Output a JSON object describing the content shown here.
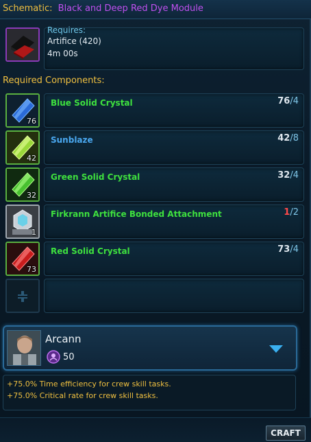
{
  "schematic": {
    "label": "Schematic:",
    "name": "Black and Deep Red Dye Module",
    "icon": "dye-module-icon",
    "requires_label": "Requires:",
    "requirement": "Artifice (420)",
    "time": "4m 00s"
  },
  "components": {
    "title": "Required Components:",
    "items": [
      {
        "name": "Blue Solid Crystal",
        "have": "76",
        "need": "/4",
        "slot_count": "76",
        "name_color": "#3ee03e",
        "insufficient": false,
        "icon": "blue-crystal-icon"
      },
      {
        "name": "Sunblaze",
        "have": "42",
        "need": "/8",
        "slot_count": "42",
        "name_color": "#4aa8f0",
        "insufficient": false,
        "icon": "sunblaze-crystal-icon"
      },
      {
        "name": "Green Solid Crystal",
        "have": "32",
        "need": "/4",
        "slot_count": "32",
        "name_color": "#3ee03e",
        "insufficient": false,
        "icon": "green-crystal-icon"
      },
      {
        "name": "Firkrann Artifice Bonded Attachment",
        "have": "1",
        "need": "/2",
        "slot_count": "1",
        "name_color": "#3ee03e",
        "insufficient": true,
        "icon": "attachment-icon"
      },
      {
        "name": "Red Solid Crystal",
        "have": "73",
        "need": "/4",
        "slot_count": "73",
        "name_color": "#3ee03e",
        "insufficient": false,
        "icon": "red-crystal-icon"
      }
    ]
  },
  "crew": {
    "name": "Arcann",
    "influence": "50",
    "effects": [
      "+75.0% Time efficiency for crew skill tasks.",
      "+75.0% Critical rate for crew skill tasks."
    ]
  },
  "craft_label": "CRAFT"
}
